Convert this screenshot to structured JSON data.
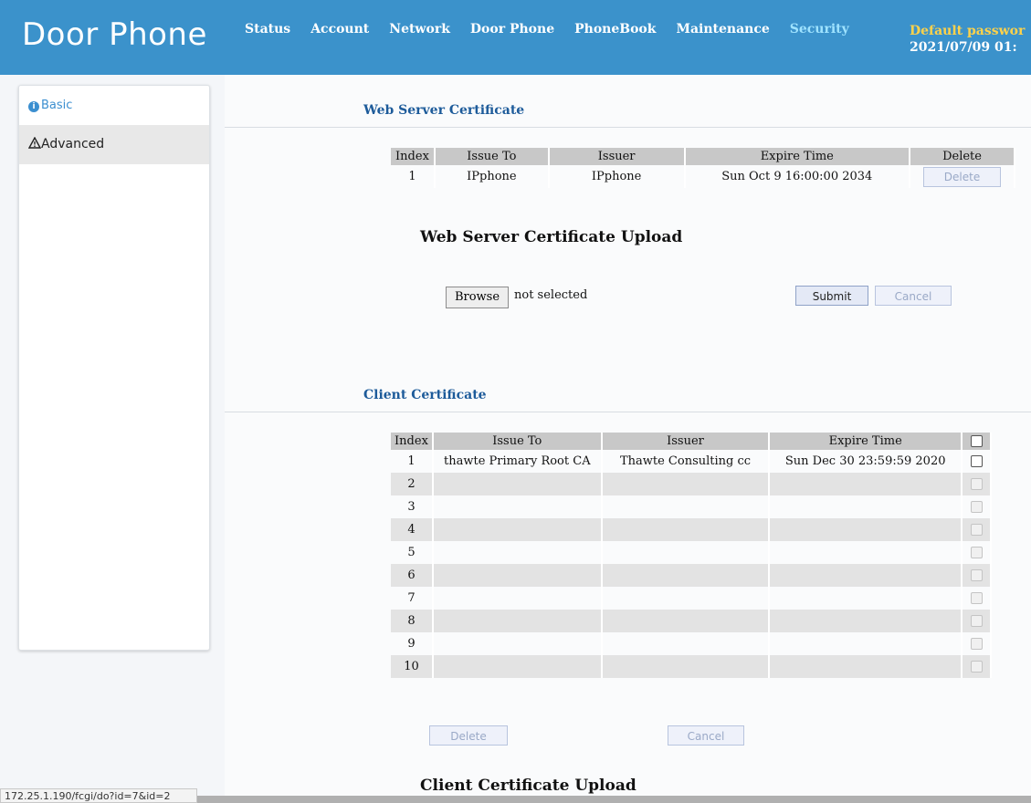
{
  "header": {
    "brand": "Door Phone",
    "nav": [
      "Status",
      "Account",
      "Network",
      "Door Phone",
      "PhoneBook",
      "Maintenance",
      "Security"
    ],
    "active_nav": "Security",
    "default_password_text": "Default passwor",
    "datetime": "2021/07/09 01:"
  },
  "sidebar": {
    "basic_label": "Basic",
    "advanced_label": "Advanced"
  },
  "web_server": {
    "title": "Web Server Certificate",
    "columns": [
      "Index",
      "Issue To",
      "Issuer",
      "Expire Time",
      "Delete"
    ],
    "rows": [
      {
        "index": "1",
        "issue_to": "IPphone",
        "issuer": "IPphone",
        "expire": "Sun Oct 9 16:00:00 2034",
        "delete_label": "Delete"
      }
    ]
  },
  "upload": {
    "title": "Web Server Certificate Upload",
    "browse_label": "Browse",
    "file_status": "not selected",
    "submit_label": "Submit",
    "cancel_label": "Cancel"
  },
  "client": {
    "title": "Client Certificate",
    "columns": [
      "Index",
      "Issue To",
      "Issuer",
      "Expire Time"
    ],
    "rows": [
      {
        "index": "1",
        "issue_to": "thawte Primary Root CA",
        "issuer": "Thawte Consulting cc",
        "expire": "Sun Dec 30 23:59:59 2020"
      },
      {
        "index": "2",
        "issue_to": "",
        "issuer": "",
        "expire": ""
      },
      {
        "index": "3",
        "issue_to": "",
        "issuer": "",
        "expire": ""
      },
      {
        "index": "4",
        "issue_to": "",
        "issuer": "",
        "expire": ""
      },
      {
        "index": "5",
        "issue_to": "",
        "issuer": "",
        "expire": ""
      },
      {
        "index": "6",
        "issue_to": "",
        "issuer": "",
        "expire": ""
      },
      {
        "index": "7",
        "issue_to": "",
        "issuer": "",
        "expire": ""
      },
      {
        "index": "8",
        "issue_to": "",
        "issuer": "",
        "expire": ""
      },
      {
        "index": "9",
        "issue_to": "",
        "issuer": "",
        "expire": ""
      },
      {
        "index": "10",
        "issue_to": "",
        "issuer": "",
        "expire": ""
      }
    ],
    "delete_label": "Delete",
    "cancel_label": "Cancel"
  },
  "client_upload": {
    "title": "Client Certificate Upload"
  },
  "status_bar": {
    "url": "172.25.1.190/fcgi/do?id=7&id=2"
  },
  "colors": {
    "header_bg": "#3b92cb",
    "active_nav": "#9fe3ff",
    "password_warning": "#ffd24a",
    "section_title": "#1d5b9a"
  },
  "icons": {
    "basic": "info-circle-icon",
    "advanced": "warning-triangle-icon"
  }
}
